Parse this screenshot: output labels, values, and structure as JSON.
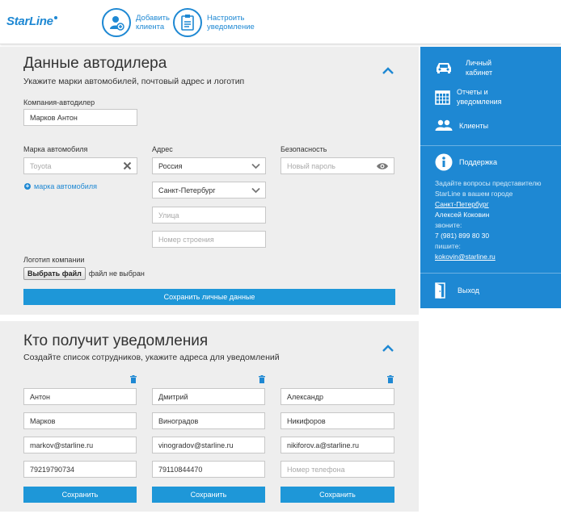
{
  "header": {
    "logo": "StarLine",
    "add_client": "Добавить клиента",
    "setup_notifications": "Настроить уведомление"
  },
  "dealer": {
    "title": "Данные автодилера",
    "subtitle": "Укажите марки автомобилей, почтовый адрес и логотип",
    "company_label": "Компания-автодилер",
    "company_value": "Марков Антон",
    "brand_label": "Марка автомобиля",
    "brand_value": "Toyota",
    "add_brand": "марка автомобиля",
    "address_label": "Адрес",
    "country": "Россия",
    "city": "Санкт-Петербург",
    "street_placeholder": "Улица",
    "building_placeholder": "Номер строения",
    "security_label": "Безопасность",
    "password_placeholder": "Новый пароль",
    "logo_label": "Логотип компании",
    "choose_file": "Выбрать файл",
    "no_file": "файл не выбран",
    "save": "Сохранить личные данные"
  },
  "notify": {
    "title": "Кто получит уведомления",
    "subtitle": "Создайте список сотрудников, укажите адреса для уведомлений",
    "save": "Сохранить",
    "phone_placeholder": "Номер телефона",
    "people": [
      {
        "first": "Антон",
        "last": "Марков",
        "email": "markov@starline.ru",
        "phone": "79219790734"
      },
      {
        "first": "Дмитрий",
        "last": "Виноградов",
        "email": "vinogradov@starline.ru",
        "phone": "79110844470"
      },
      {
        "first": "Александр",
        "last": "Никифоров",
        "email": "nikiforov.a@starline.ru",
        "phone": ""
      }
    ]
  },
  "sidebar": {
    "cabinet": "Личный кабинет",
    "reports": "Отчеты и уведомления",
    "clients": "Клиенты",
    "support": "Поддержка",
    "support_text_1": "Задайте вопросы представителю",
    "support_text_2": "StarLine в вашем городе",
    "support_city": "Санкт-Петербург",
    "support_person": "Алексей  Коковин",
    "call_label": "звоните:",
    "phone": "7 (981) 899 80 30",
    "write_label": "пишите:",
    "email": "kokovin@starline.ru",
    "logout": "Выход"
  },
  "colors": {
    "accent": "#1e88d3",
    "button": "#1e97d8",
    "panel": "#eeeeee"
  },
  "icons": [
    "user-plus-icon",
    "clipboard-icon",
    "chevron-up-icon",
    "clear-x-icon",
    "dropdown-arrow-icon",
    "eye-icon",
    "plus-icon",
    "trash-icon",
    "car-icon",
    "calendar-icon",
    "users-icon",
    "info-icon",
    "door-exit-icon"
  ]
}
